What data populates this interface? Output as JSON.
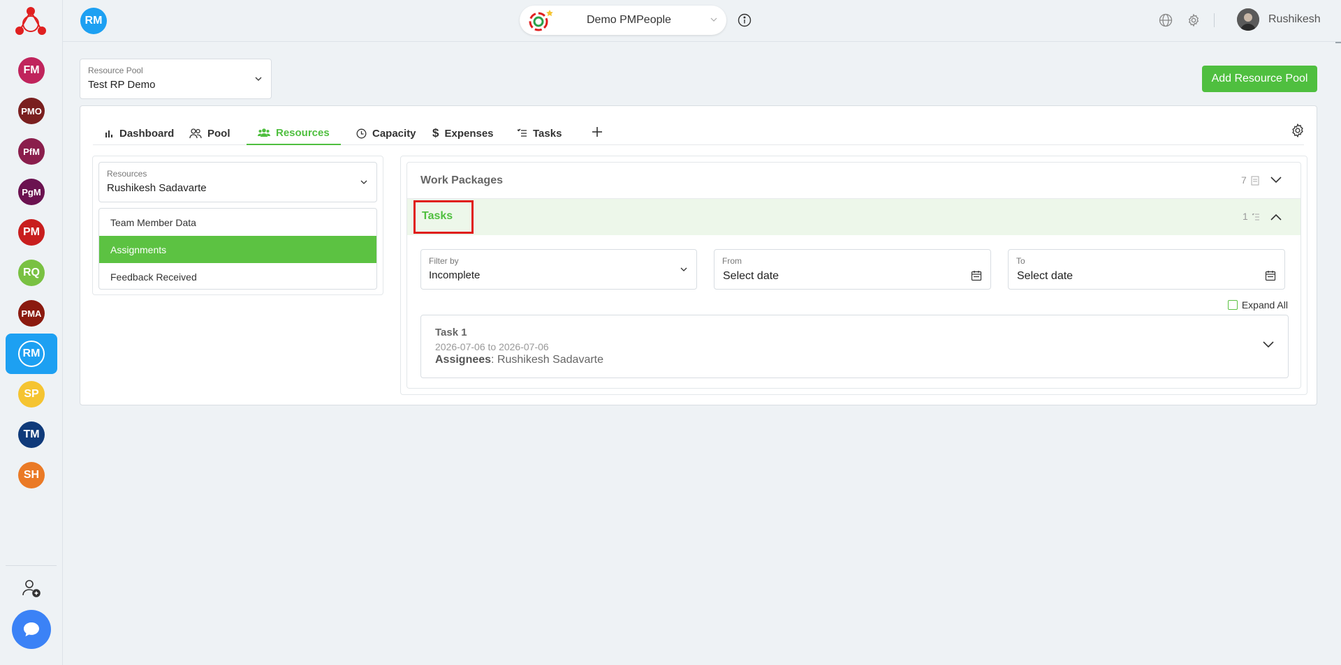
{
  "workspace": {
    "name": "Demo PMPeople"
  },
  "user": {
    "name": "Rushikesh"
  },
  "current_app": {
    "badge": "RM"
  },
  "apps": [
    {
      "label": "FM",
      "color": "#c0245c"
    },
    {
      "label": "PMO",
      "color": "#7a1f1f"
    },
    {
      "label": "PfM",
      "color": "#8a1e4c"
    },
    {
      "label": "PgM",
      "color": "#6b1250"
    },
    {
      "label": "PM",
      "color": "#c81e1e"
    },
    {
      "label": "RQ",
      "color": "#79c142"
    },
    {
      "label": "PMA",
      "color": "#8b1a0f"
    },
    {
      "label": "RM",
      "color": "#1da0f2"
    },
    {
      "label": "SP",
      "color": "#f5c431"
    },
    {
      "label": "TM",
      "color": "#0f3a7a"
    },
    {
      "label": "SH",
      "color": "#ea7a26"
    }
  ],
  "resource_pool": {
    "label": "Resource Pool",
    "value": "Test RP Demo"
  },
  "add_pool_button": "Add Resource Pool",
  "tabs": [
    {
      "label": "Dashboard",
      "icon": "bar-chart-icon"
    },
    {
      "label": "Pool",
      "icon": "users-icon"
    },
    {
      "label": "Resources",
      "icon": "team-icon"
    },
    {
      "label": "Capacity",
      "icon": "clock-icon"
    },
    {
      "label": "Expenses",
      "icon": "dollar-icon"
    },
    {
      "label": "Tasks",
      "icon": "task-list-icon"
    }
  ],
  "active_tab": "Resources",
  "resources_select": {
    "label": "Resources",
    "value": "Rushikesh Sadavarte"
  },
  "menu": [
    {
      "label": "Team Member Data"
    },
    {
      "label": "Assignments"
    },
    {
      "label": "Feedback Received"
    }
  ],
  "active_menu": "Assignments",
  "work_packages": {
    "title": "Work Packages",
    "count": "7"
  },
  "tasks_section": {
    "title": "Tasks",
    "count": "1"
  },
  "filter": {
    "label": "Filter by",
    "value": "Incomplete"
  },
  "from": {
    "label": "From",
    "value": "Select date"
  },
  "to": {
    "label": "To",
    "value": "Select date"
  },
  "expand_all": "Expand All",
  "task_items": [
    {
      "name": "Task 1",
      "dates": "2026-07-06 to 2026-07-06",
      "assignees_label": "Assignees",
      "assignees_value": ": Rushikesh Sadavarte"
    }
  ],
  "colors": {
    "accent": "#4fbf3f",
    "primary": "#1da0f2",
    "highlight_border": "#e01b1b"
  }
}
